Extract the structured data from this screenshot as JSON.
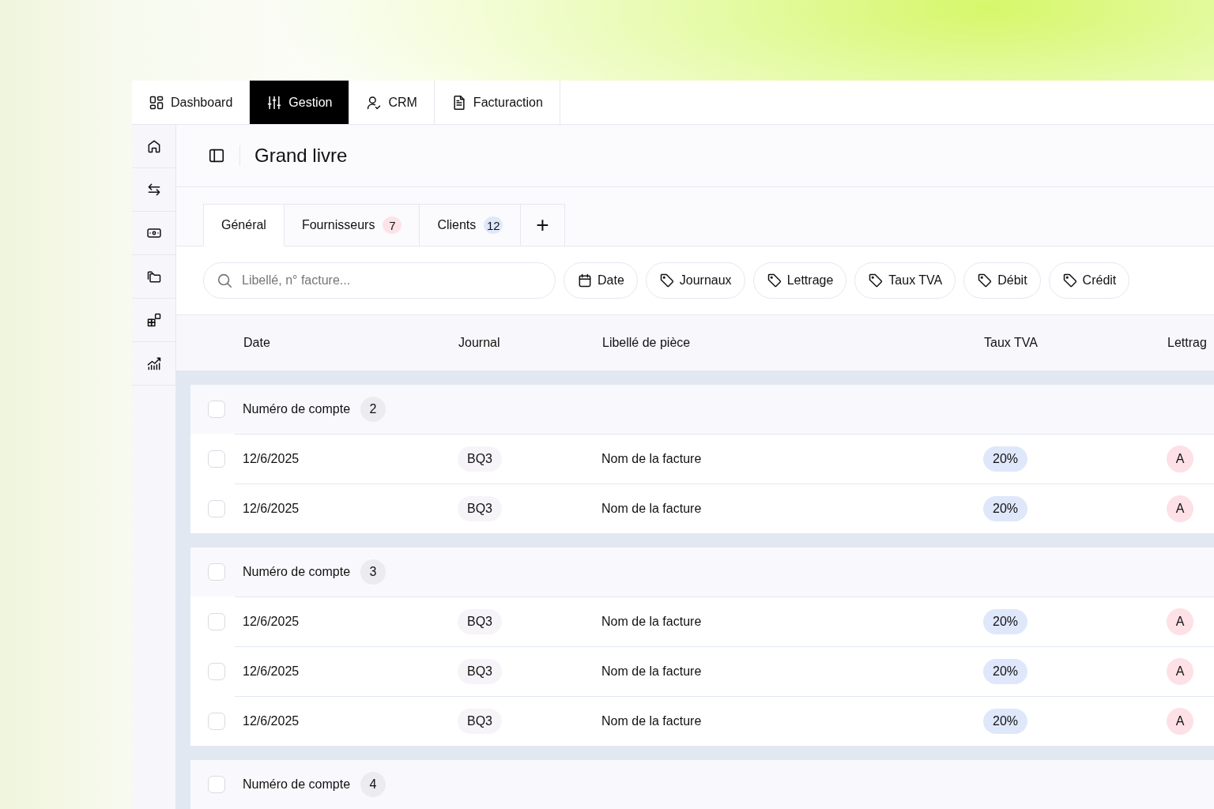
{
  "top_tabs": [
    {
      "label": "Dashboard",
      "selected": false
    },
    {
      "label": "Gestion",
      "selected": true
    },
    {
      "label": "CRM",
      "selected": false
    },
    {
      "label": "Facturaction",
      "selected": false
    }
  ],
  "page_title": "Grand livre",
  "view_tabs": [
    {
      "label": "Général",
      "selected": true
    },
    {
      "label": "Fournisseurs",
      "selected": false,
      "count": "7",
      "color": "#fde3e7"
    },
    {
      "label": "Clients",
      "selected": false,
      "count": "12",
      "color": "#dfe8fb"
    }
  ],
  "add_tab": "+",
  "search": {
    "placeholder": "Libellé, n° facture..."
  },
  "filters": [
    {
      "kind": "date",
      "label": "Date"
    },
    {
      "kind": "tag",
      "label": "Journaux"
    },
    {
      "kind": "tag",
      "label": "Lettrage"
    },
    {
      "kind": "tag",
      "label": "Taux TVA"
    },
    {
      "kind": "tag",
      "label": "Débit"
    },
    {
      "kind": "tag",
      "label": "Crédit"
    }
  ],
  "table": {
    "columns": [
      "Date",
      "Journal",
      "Libellé de pièce",
      "Taux TVA",
      "Lettrag"
    ],
    "groups": [
      {
        "label": "Numéro de compte",
        "count": "2",
        "checked": false,
        "rows": [
          {
            "checked": false,
            "date": "12/6/2025",
            "journal": "BQ3",
            "libelle": "Nom de la facture",
            "tva": "20%",
            "lettrage": "A"
          },
          {
            "checked": false,
            "date": "12/6/2025",
            "journal": "BQ3",
            "libelle": "Nom de la facture",
            "tva": "20%",
            "lettrage": "A"
          }
        ]
      },
      {
        "label": "Numéro de compte",
        "count": "3",
        "checked": false,
        "rows": [
          {
            "checked": false,
            "date": "12/6/2025",
            "journal": "BQ3",
            "libelle": "Nom de la facture",
            "tva": "20%",
            "lettrage": "A"
          },
          {
            "checked": false,
            "date": "12/6/2025",
            "journal": "BQ3",
            "libelle": "Nom de la facture",
            "tva": "20%",
            "lettrage": "A"
          },
          {
            "checked": false,
            "date": "12/6/2025",
            "journal": "BQ3",
            "libelle": "Nom de la facture",
            "tva": "20%",
            "lettrage": "A"
          }
        ]
      },
      {
        "label": "Numéro de compte",
        "count": "4",
        "checked": false
      }
    ]
  }
}
